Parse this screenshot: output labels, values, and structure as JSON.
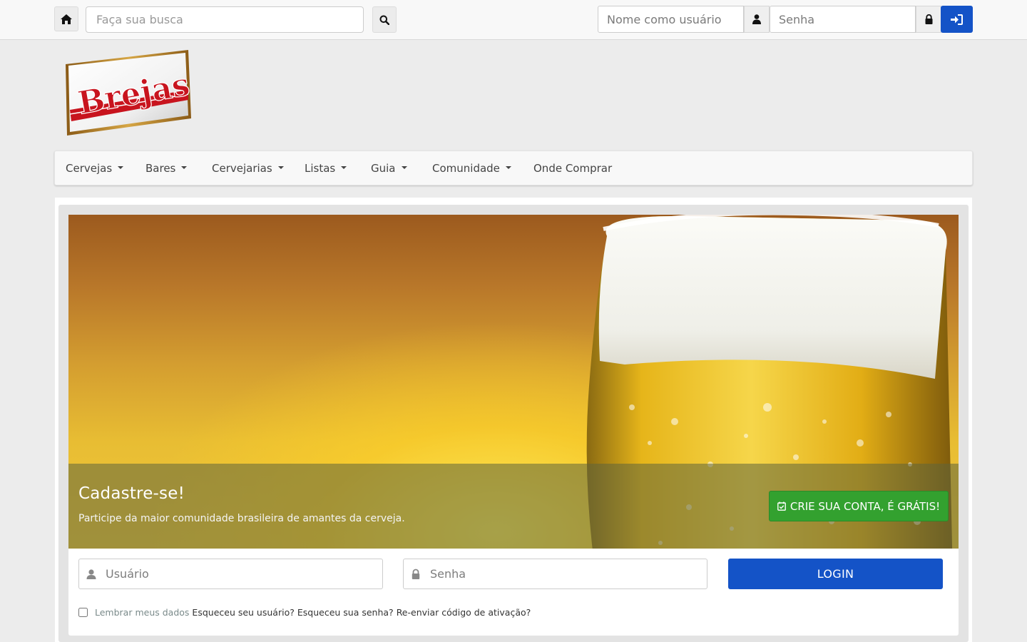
{
  "topbar": {
    "search_placeholder": "Faça sua busca",
    "user_placeholder": "Nome como usuário",
    "password_placeholder": "Senha",
    "icons": {
      "home": "home-icon",
      "search": "search-icon",
      "user": "user-icon",
      "lock": "lock-icon",
      "signin": "sign-in-icon"
    }
  },
  "logo": {
    "text": "Brejas"
  },
  "nav": {
    "items": [
      {
        "label": "Cervejas",
        "dropdown": true
      },
      {
        "label": "Bares",
        "dropdown": true
      },
      {
        "label": "Cervejarias",
        "dropdown": true
      },
      {
        "label": "Listas",
        "dropdown": true
      },
      {
        "label": "Guia",
        "dropdown": true
      },
      {
        "label": "Comunidade",
        "dropdown": true
      },
      {
        "label": "Onde Comprar",
        "dropdown": false
      }
    ]
  },
  "hero": {
    "title": "Cadastre-se!",
    "subtitle": "Participe da maior comunidade brasileira de amantes da cerveja.",
    "cta_label": "CRIE SUA CONTA, É GRÁTIS!"
  },
  "login": {
    "user_placeholder": "Usuário",
    "password_placeholder": "Senha",
    "button_label": "LOGIN",
    "remember_label": "Lembrar meus dados",
    "forgot_user": "Esqueceu seu usuário?",
    "forgot_password": "Esqueceu sua senha?",
    "resend_code": "Re-enviar código de ativação?"
  },
  "colors": {
    "primary": "#1453c7",
    "success": "#33a12f",
    "logo_red": "#c8141e",
    "logo_gold": "#b8862c"
  }
}
